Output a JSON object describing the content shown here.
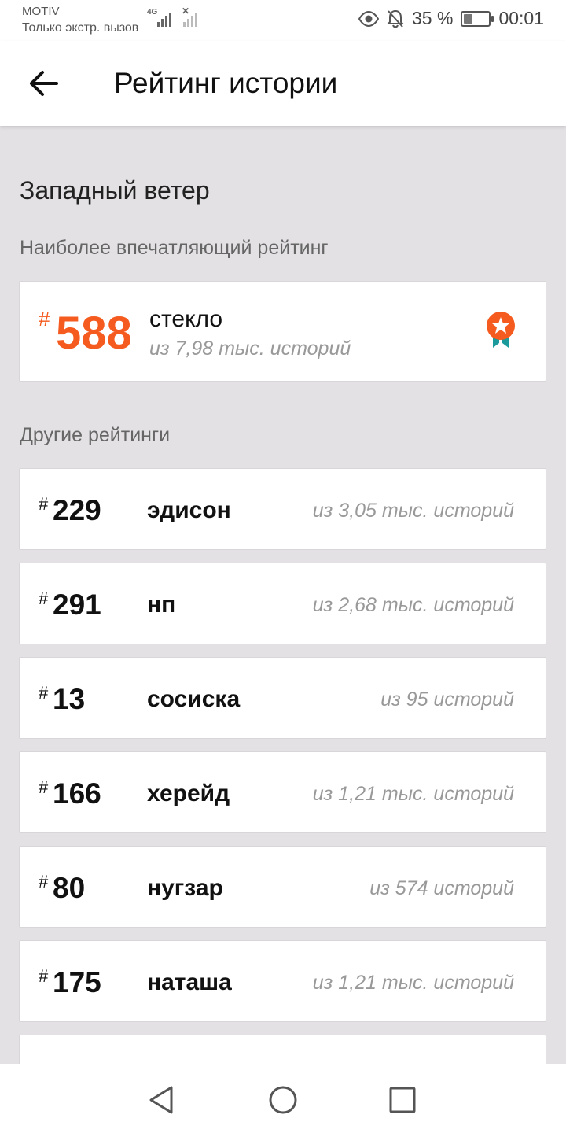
{
  "status_bar": {
    "carrier": "MOTIV",
    "carrier_subtitle": "Только экстр. вызов",
    "network": "4G",
    "battery_percent": "35 %",
    "battery_level": 0.35,
    "time": "00:01"
  },
  "app_bar": {
    "title": "Рейтинг истории"
  },
  "story": {
    "name": "Западный ветер"
  },
  "highlight": {
    "label": "Наиболее впечатляющий рейтинг",
    "hash": "#",
    "rank": "588",
    "tag": "стекло",
    "of": "из 7,98 тыс. историй"
  },
  "others": {
    "label": "Другие рейтинги",
    "items": [
      {
        "hash": "#",
        "rank": "229",
        "tag": "эдисон",
        "of": "из 3,05 тыс. историй"
      },
      {
        "hash": "#",
        "rank": "291",
        "tag": "нп",
        "of": "из 2,68 тыс. историй"
      },
      {
        "hash": "#",
        "rank": "13",
        "tag": "сосиска",
        "of": "из 95 историй"
      },
      {
        "hash": "#",
        "rank": "166",
        "tag": "херейд",
        "of": "из 1,21 тыс. историй"
      },
      {
        "hash": "#",
        "rank": "80",
        "tag": "нугзар",
        "of": "из 574 историй"
      },
      {
        "hash": "#",
        "rank": "175",
        "tag": "наташа",
        "of": "из 1,21 тыс. историй"
      }
    ]
  },
  "colors": {
    "accent": "#f55a1e",
    "medal_ribbon": "#1a9a9a",
    "background": "#e3e1e4"
  }
}
